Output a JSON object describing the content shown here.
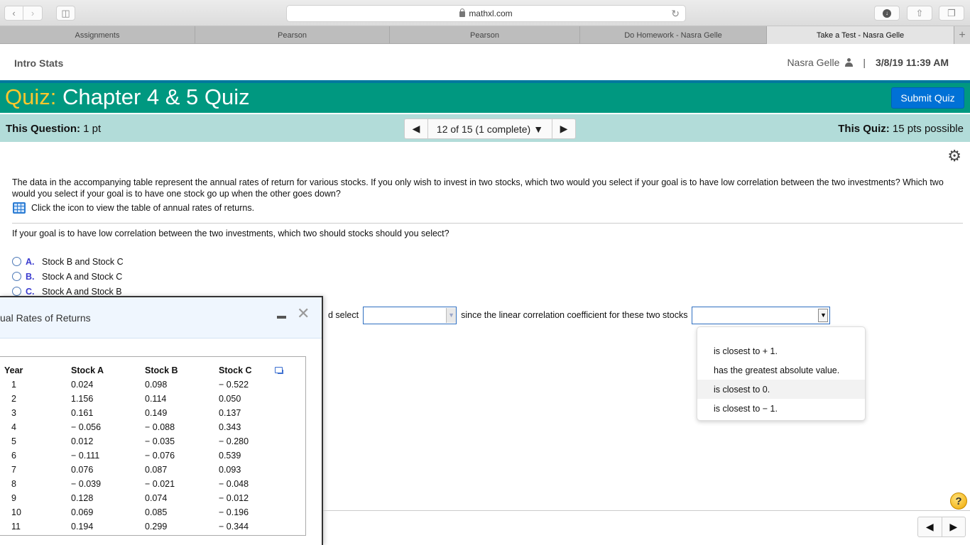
{
  "browser": {
    "url": "mathxl.com",
    "tabs": [
      {
        "label": "Assignments",
        "active": false
      },
      {
        "label": "Pearson",
        "active": false
      },
      {
        "label": "Pearson",
        "active": false
      },
      {
        "label": "Do Homework - Nasra Gelle",
        "active": false
      },
      {
        "label": "Take a Test - Nasra Gelle",
        "active": true
      }
    ],
    "new_tab": "+"
  },
  "header": {
    "course": "Intro Stats",
    "user": "Nasra Gelle",
    "separator": "|",
    "datetime": "3/8/19 11:39 AM"
  },
  "quiz": {
    "prefix": "Quiz:",
    "title": "Chapter 4 & 5 Quiz",
    "submit_label": "Submit Quiz",
    "question_label": "This Question:",
    "question_points": "1 pt",
    "pager_text": "12 of 15 (1 complete)",
    "quiz_label": "This Quiz:",
    "quiz_points": "15 pts possible"
  },
  "question": {
    "text": "The data in the accompanying table represent the annual rates of return for various stocks. If you only wish to invest in two stocks, which two would you select if your goal is to have low correlation between the two investments? Which two would you select if your goal is to have one stock go up when the other goes down?",
    "table_link": "Click the icon to view the table of annual rates of returns.",
    "subquestion": "If your goal is to have low correlation between the two investments, which two should stocks should you select?",
    "options": [
      {
        "letter": "A.",
        "text": "Stock B and Stock C"
      },
      {
        "letter": "B.",
        "text": "Stock A and Stock C"
      },
      {
        "letter": "C.",
        "text": "Stock A and Stock B"
      }
    ],
    "answer_prefix": "d select",
    "answer_middle": "since the linear correlation coefficient for these two stocks",
    "select1_value": "",
    "select2_value": "",
    "dropdown_options": [
      "is closest to  + 1.",
      "has the greatest absolute value.",
      "is closest to 0.",
      "is closest to  − 1."
    ],
    "dropdown_highlighted": 2
  },
  "data_window": {
    "title": "ual Rates of Returns",
    "columns": [
      "Year",
      "Stock A",
      "Stock B",
      "Stock C"
    ],
    "rows": [
      [
        "1",
        "0.024",
        "0.098",
        "− 0.522"
      ],
      [
        "2",
        "1.156",
        "0.114",
        "0.050"
      ],
      [
        "3",
        "0.161",
        "0.149",
        "0.137"
      ],
      [
        "4",
        "− 0.056",
        "− 0.088",
        "0.343"
      ],
      [
        "5",
        "0.012",
        "− 0.035",
        "− 0.280"
      ],
      [
        "6",
        "− 0.111",
        "− 0.076",
        "0.539"
      ],
      [
        "7",
        "0.076",
        "0.087",
        "0.093"
      ],
      [
        "8",
        "− 0.039",
        "− 0.021",
        "− 0.048"
      ],
      [
        "9",
        "0.128",
        "0.074",
        "− 0.012"
      ],
      [
        "10",
        "0.069",
        "0.085",
        "− 0.196"
      ],
      [
        "11",
        "0.194",
        "0.299",
        "− 0.344"
      ]
    ]
  },
  "footer": {
    "help": "?"
  },
  "colors": {
    "quiz_bar": "#009880",
    "quiz_prefix": "#ffc72c",
    "question_bar": "#b2dcd9",
    "submit_button": "#0071d6",
    "option_letter": "#3b3bcf"
  }
}
